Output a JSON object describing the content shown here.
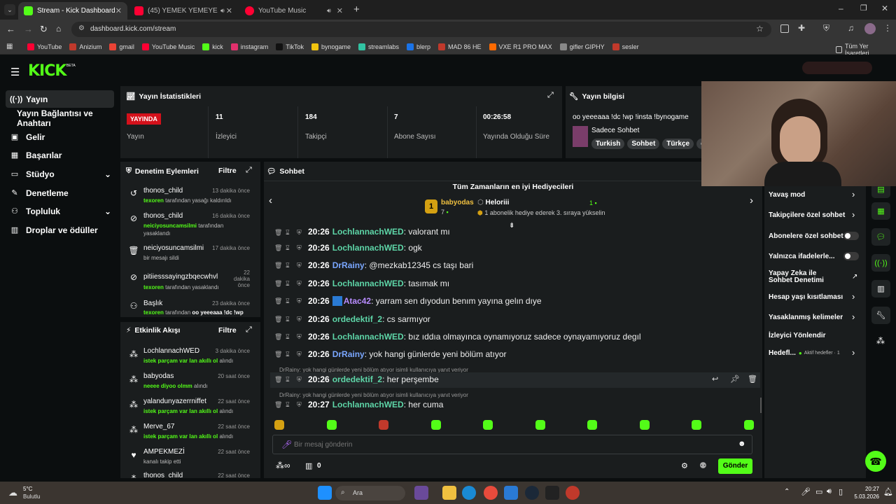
{
  "browser": {
    "tabs": [
      {
        "title": "Stream - Kick Dashboard",
        "color": "#53fc18"
      },
      {
        "title": "(45) YEMEK YEMEYE OTURU",
        "color": "#ff0033"
      },
      {
        "title": "YouTube Music",
        "color": "#ff0033"
      }
    ],
    "url": "dashboard.kick.com/stream",
    "bookmarks": [
      "YouTube",
      "Anizium",
      "gmail",
      "YouTube Music",
      "kick",
      "instagram",
      "TikTok",
      "bynogame",
      "streamlabs",
      "blerp",
      "MAD 86 HE",
      "VXE R1 PRO MAX",
      "gifler GIPHY",
      "sesler"
    ],
    "bookmark_colors": [
      "#ff0033",
      "#c0392b",
      "#ea4335",
      "#ff0033",
      "#53fc18",
      "#e1306c",
      "#111111",
      "#f1c40f",
      "#31c3a2",
      "#1a73e8",
      "#c0392b",
      "#ff6a00",
      "#888888",
      "#c0392b"
    ],
    "all_bookmarks": "Tüm Yer İşaretleri"
  },
  "brand": {
    "logo": "KICK",
    "badge": "BETA"
  },
  "nav": {
    "items": [
      {
        "label": "Yayın",
        "icon": "broadcast-icon"
      },
      {
        "label": "Yayın Bağlantısı ve Anahtarı"
      },
      {
        "label": "Gelir",
        "icon": "revenue-icon"
      },
      {
        "label": "Başarılar",
        "icon": "achievements-icon"
      },
      {
        "label": "Stüdyo",
        "icon": "studio-icon"
      },
      {
        "label": "Denetleme",
        "icon": "moderation-icon"
      },
      {
        "label": "Topluluk",
        "icon": "community-icon"
      },
      {
        "label": "Droplar ve ödüller",
        "icon": "drops-icon"
      }
    ]
  },
  "stats": {
    "title": "Yayın İstatistikleri",
    "live_badge": "YAYINDA",
    "items": [
      {
        "value": "",
        "label": "Yayın"
      },
      {
        "value": "11",
        "label": "İzleyici"
      },
      {
        "value": "184",
        "label": "Takipçi"
      },
      {
        "value": "7",
        "label": "Abone Sayısı"
      },
      {
        "value": "00:26:58",
        "label": "Yayında Olduğu Süre"
      }
    ]
  },
  "stream_info": {
    "title": "Yayın bilgisi",
    "stream_title": "oo yeeeaaa !dc !wp !insta !bynogame",
    "category": "Sadece Sohbet",
    "tags": [
      "Turkish",
      "Sohbet",
      "Türkçe",
      "ch"
    ]
  },
  "mod_actions": {
    "title": "Denetim Eylemleri",
    "filter": "Filtre",
    "items": [
      {
        "name": "thonos_child",
        "time": "13 dakika önce",
        "who": "texoren",
        "text": "tarafından yasağı kaldırıldı",
        "icon": "unban-icon"
      },
      {
        "name": "thonos_child",
        "time": "16 dakika önce",
        "who": "neiciyosuncamsilmi",
        "text": "tarafından yasaklandı",
        "icon": "ban-icon"
      },
      {
        "name": "neiciyosuncamsilmi",
        "time": "17 dakika önce",
        "who": "",
        "text": "bir mesajı sildi",
        "icon": "trash-icon"
      },
      {
        "name": "pitiiesssayingzbqecwhvl",
        "time": "22 dakika önce",
        "who": "texoren",
        "text": "tarafından yasaklandı",
        "icon": "ban-icon"
      },
      {
        "name": "Başlık",
        "time": "23 dakika önce",
        "who": "texoren",
        "text": "tarafından",
        "extra": "oo yeeeaaa !dc !wp",
        "icon": "title-icon"
      }
    ]
  },
  "activity": {
    "title": "Etkinlik Akışı",
    "filter": "Filtre",
    "items": [
      {
        "name": "LochlannachWED",
        "time": "3 dakika önce",
        "hl": "istek parçam var lan akıllı ol",
        "text": "alındı",
        "icon": "kicks-icon"
      },
      {
        "name": "babyodas",
        "time": "20 saat önce",
        "hl": "neeee diyoo olmm",
        "text": "alındı",
        "icon": "kicks-icon"
      },
      {
        "name": "yalandunyazerrniffet",
        "time": "22 saat önce",
        "hl": "istek parçam var lan akıllı ol",
        "text": "alındı",
        "icon": "kicks-icon"
      },
      {
        "name": "Merve_67",
        "time": "22 saat önce",
        "hl": "istek parçam var lan akıllı ol",
        "text": "alındı",
        "icon": "kicks-icon"
      },
      {
        "name": "AMPEKMEZİ",
        "time": "22 saat önce",
        "hl": "",
        "text": "kanalı takip etti",
        "icon": "heart-icon"
      },
      {
        "name": "thonos_child",
        "time": "22 saat önce",
        "hl": "",
        "text": "",
        "icon": "kicks-icon"
      }
    ]
  },
  "chat": {
    "title": "Sohbet",
    "gifters_title": "Tüm Zamanların en iyi Hediyecileri",
    "top_gifter": {
      "rank": "1",
      "name": "babyodas",
      "count": "7"
    },
    "second": {
      "name": "Heloriii",
      "count": "1",
      "note": "1 abonelik hediye ederek 3. sıraya yükselin"
    },
    "messages": [
      {
        "time": "20:26",
        "user": "LochlannachWED",
        "color": "#5ed6a8",
        "text": "valorant mı"
      },
      {
        "time": "20:26",
        "user": "LochlannachWED",
        "color": "#5ed6a8",
        "text": "ogk"
      },
      {
        "time": "20:26",
        "user": "DrRainy",
        "color": "#7aa7ff",
        "text": "@mezkab12345 cs taşı bari"
      },
      {
        "time": "20:26",
        "user": "LochlannachWED",
        "color": "#5ed6a8",
        "text": "tasımak mı"
      },
      {
        "time": "20:26",
        "user": "Atac42",
        "color": "#b88cff",
        "text": "yarram sen dıyodun benım yayına gelın dıye"
      },
      {
        "time": "20:26",
        "user": "ordedektif_2",
        "color": "#5ed6a8",
        "text": "cs sarmıyor"
      },
      {
        "time": "20:26",
        "user": "LochlannachWED",
        "color": "#5ed6a8",
        "text": "bız ıddıa olmayınca oynamıyoruz sadece oynayamıyoruz degıl"
      },
      {
        "time": "20:26",
        "user": "DrRainy",
        "color": "#7aa7ff",
        "text": "yok hangi günlerde yeni bölüm atıyor"
      }
    ],
    "reply1": {
      "note": "DrRainy: yok hangi günlerde yeni bölüm atıyor isimli kullanıcıya yanıt veriyor",
      "time": "20:26",
      "user": "ordedektif_2",
      "text": "her perşembe"
    },
    "reply2": {
      "note": "DrRainy: yok hangi günlerde yeni bölüm atıyor isimli kullanıcıya yanıt veriyor",
      "time": "20:27",
      "user": "LochlannachWED",
      "text": "her cuma"
    },
    "input_placeholder": "Bir mesaj gönderin",
    "kicks_count": "0",
    "send": "Gönder"
  },
  "chat_settings": {
    "items": [
      {
        "label": "Yavaş mod",
        "type": "chevron"
      },
      {
        "label": "Takipçilere özel sohbet",
        "type": "chevron"
      },
      {
        "label": "Abonelere özel sohbet",
        "type": "toggle"
      },
      {
        "label": "Yalnızca ifadelerle...",
        "type": "toggle"
      },
      {
        "label": "Yapay Zeka ile Sohbet Denetimi",
        "type": "external"
      },
      {
        "label": "Hesap yaşı kısıtlaması",
        "type": "chevron"
      },
      {
        "label": "Yasaklanmış kelimeler",
        "type": "chevron"
      },
      {
        "label": "İzleyici Yönlendir",
        "type": "none"
      },
      {
        "label": "Hedefl...",
        "type": "chevron",
        "extra": "Aktif hedefler · 1"
      }
    ]
  },
  "taskbar": {
    "weather_temp": "5°C",
    "weather_text": "Bulutlu",
    "search": "Ara",
    "time": "20:27",
    "date": "5.03.2026"
  }
}
